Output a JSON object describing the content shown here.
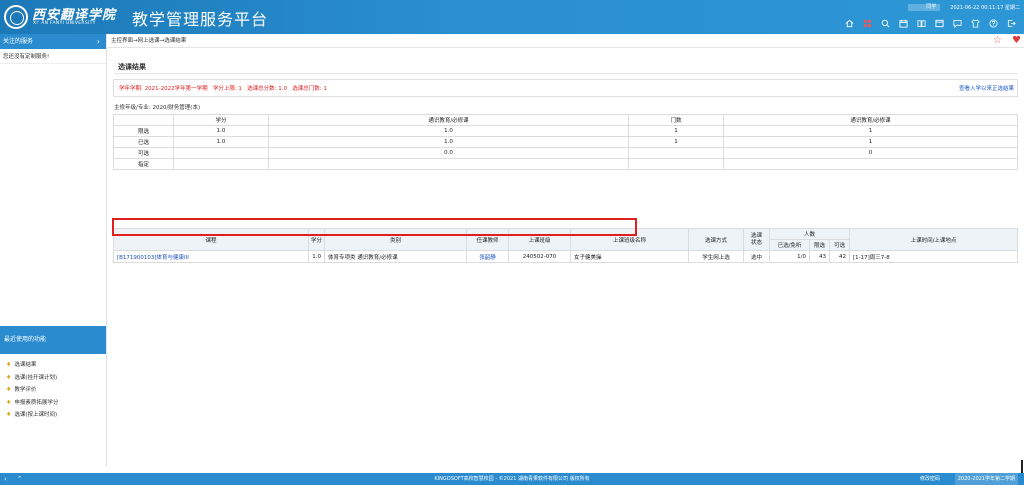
{
  "header": {
    "logo_cn": "西安翻译学院",
    "logo_en": "XI' AN FANYI UNIVERSITY",
    "platform_title": "教学管理服务平台",
    "user_name": "同学",
    "datetime": "2021-06-22 00:11:17 星期二",
    "icons": [
      "home-icon",
      "grid-icon",
      "search-icon",
      "calendar-icon",
      "book-icon",
      "window-icon",
      "message-icon",
      "shirt-icon",
      "help-icon",
      "logout-icon"
    ]
  },
  "sidebar": {
    "header_label": "关注的服务",
    "chevron": "›",
    "empty_text": "您还没有定制服务!",
    "recent_header": "最近使用的功能",
    "recent_items": [
      {
        "label": "选课结果"
      },
      {
        "label": "选课(挂开课计划)"
      },
      {
        "label": "教学评价"
      },
      {
        "label": "申报素质拓展学分"
      },
      {
        "label": "选课(按上课时间)"
      }
    ]
  },
  "main": {
    "breadcrumb": "主控界面→网上选课→选课结果",
    "section_title": "选课结果",
    "term_info": "学年学期: 2021-2022学年第一学期   学分上限: 1   选课总分数: 1.0   选课总门数: 1",
    "term_link": "查看入学以来正选结果",
    "grade_major": "主修年级/专业: 2020/财务管理(本)"
  },
  "summary_table": {
    "header": {
      "credit": "学分",
      "category_a": "通识教育/必修课",
      "count": "门数",
      "category_b": "通识教育/必修课"
    },
    "rows": [
      {
        "label": "限选",
        "credit": "1.0",
        "cat_a": "1.0",
        "count": "1",
        "cat_b": "1"
      },
      {
        "label": "已选",
        "credit": "1.0",
        "cat_a": "1.0",
        "count": "1",
        "cat_b": "1"
      },
      {
        "label": "可选",
        "credit": "",
        "cat_a": "0.0",
        "count": "",
        "cat_b": "0"
      },
      {
        "label": "指定",
        "credit": "",
        "cat_a": "",
        "count": "",
        "cat_b": ""
      }
    ]
  },
  "course_table": {
    "headers": {
      "course": "课程",
      "credit": "学分",
      "category": "类别",
      "teacher": "任课教师",
      "class_code": "上课班级",
      "class_name": "上课班级名称",
      "method": "选课方式",
      "status": "选课\n状态",
      "people": "人数",
      "selected_cap": "已选/免听",
      "limit": "限选",
      "available": "可选",
      "time_place": "上课时间/上课地点"
    },
    "rows": [
      {
        "course": "[B171900103]体育与健康III",
        "credit": "1.0",
        "category": "体育专项类  通识教育/必修课",
        "teacher": "张韶静",
        "class_code": "240502-070",
        "class_name": "女子健美操",
        "method": "学生网上选",
        "status": "选中",
        "selected_cap": "1/0",
        "limit": "43",
        "available": "42",
        "time_place": "[1-17]周三7-8"
      }
    ]
  },
  "footer": {
    "nav_left": "‹",
    "nav_up": "⌃",
    "copyright": "KINGOSOFT高校智慧校园 - ©2021  湖南青果软件有限公司  版权所有",
    "change_password": "修改密码",
    "term": "2020-2021学年第二学期"
  },
  "colors": {
    "header_blue": "#2a8ccf",
    "highlight_red": "#e02020",
    "link_blue": "#1b4fbf"
  }
}
